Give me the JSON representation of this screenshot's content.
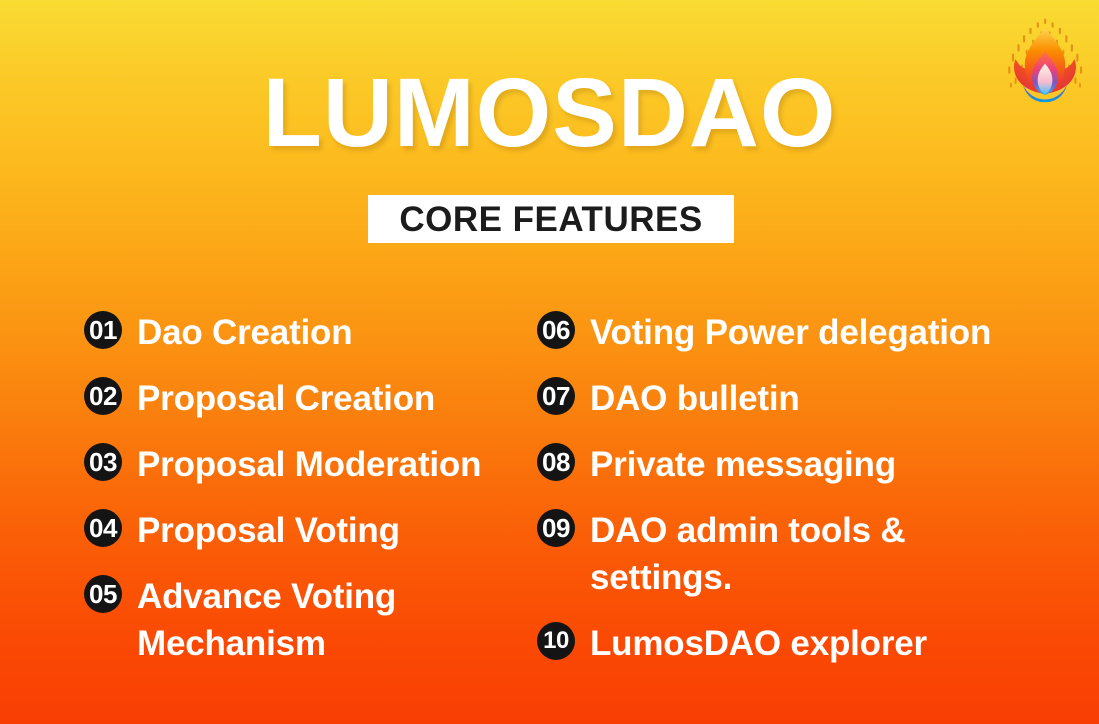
{
  "poster": {
    "title": "LUMOSDAO",
    "banner_label": "CORE FEATURES",
    "logo_icon": "flame-logo-icon",
    "background_top_color": "#F9DC33",
    "background_bottom_color": "#F93E04",
    "banner_background_color": "#FFFFFF",
    "banner_text_color": "#1C1C1C",
    "badge_background_color": "#141414",
    "text_color": "#FFFFFF"
  },
  "features": {
    "left_column": [
      {
        "number": "01",
        "label": "Dao Creation"
      },
      {
        "number": "02",
        "label": "Proposal Creation"
      },
      {
        "number": "03",
        "label": "Proposal Moderation"
      },
      {
        "number": "04",
        "label": "Proposal Voting"
      },
      {
        "number": "05",
        "label": "Advance Voting Mechanism"
      }
    ],
    "right_column": [
      {
        "number": "06",
        "label": "Voting Power delegation"
      },
      {
        "number": "07",
        "label": "DAO bulletin"
      },
      {
        "number": "08",
        "label": "Private messaging"
      },
      {
        "number": "09",
        "label": "DAO admin tools & settings."
      },
      {
        "number": "10",
        "label": "LumosDAO explorer"
      }
    ]
  }
}
